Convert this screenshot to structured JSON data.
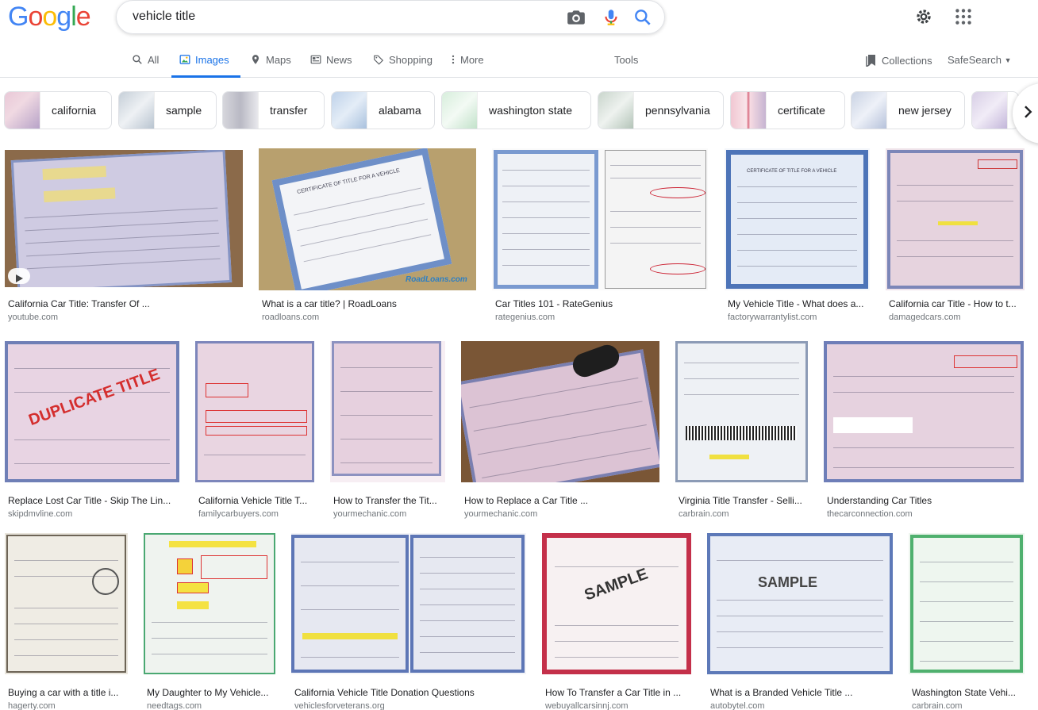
{
  "search": {
    "query": "vehicle title"
  },
  "tabs": [
    {
      "label": "All",
      "icon": "search-icon"
    },
    {
      "label": "Images",
      "icon": "image-icon",
      "active": true
    },
    {
      "label": "Maps",
      "icon": "map-pin-icon"
    },
    {
      "label": "News",
      "icon": "news-icon"
    },
    {
      "label": "Shopping",
      "icon": "tag-icon"
    },
    {
      "label": "More",
      "icon": "more-vert-icon"
    }
  ],
  "tools_label": "Tools",
  "collections_label": "Collections",
  "safesearch_label": "SafeSearch",
  "chips": [
    {
      "label": "california"
    },
    {
      "label": "sample"
    },
    {
      "label": "transfer"
    },
    {
      "label": "alabama"
    },
    {
      "label": "washington state"
    },
    {
      "label": "pennsylvania"
    },
    {
      "label": "certificate"
    },
    {
      "label": "new jersey"
    }
  ],
  "results": [
    {
      "title": "California Car Title: Transfer Of ...",
      "source": "youtube.com"
    },
    {
      "title": "What is a car title? | RoadLoans",
      "source": "roadloans.com"
    },
    {
      "title": "Car Titles 101 - RateGenius",
      "source": "rategenius.com"
    },
    {
      "title": "My Vehicle Title - What does a...",
      "source": "factorywarrantylist.com"
    },
    {
      "title": "California car Title - How to t...",
      "source": "damagedcars.com"
    },
    {
      "title": "Replace Lost Car Title - Skip The Lin...",
      "source": "skipdmvline.com"
    },
    {
      "title": "California Vehicle Title T...",
      "source": "familycarbuyers.com"
    },
    {
      "title": "How to Transfer the Tit...",
      "source": "yourmechanic.com"
    },
    {
      "title": "How to Replace a Car Title ...",
      "source": "yourmechanic.com"
    },
    {
      "title": "Virginia Title Transfer - Selli...",
      "source": "carbrain.com"
    },
    {
      "title": "Understanding Car Titles",
      "source": "thecarconnection.com"
    },
    {
      "title": "Buying a car with a title i...",
      "source": "hagerty.com"
    },
    {
      "title": "My Daughter to My Vehicle...",
      "source": "needtags.com"
    },
    {
      "title": "California Vehicle Title Donation Questions",
      "source": "vehiclesforveterans.org"
    },
    {
      "title": "How To Transfer a Car Title in ...",
      "source": "webuyallcarsinnj.com"
    },
    {
      "title": "What is a Branded Vehicle Title ...",
      "source": "autobytel.com"
    },
    {
      "title": "Washington State Vehi...",
      "source": "carbrain.com"
    }
  ],
  "image_texts": {
    "roadloans_watermark": "RoadLoans.com",
    "duplicate_stamp": "DUPLICATE TITLE",
    "sample_stamp": "SAMPLE",
    "sample_stamp_2": "SAMPLE"
  }
}
